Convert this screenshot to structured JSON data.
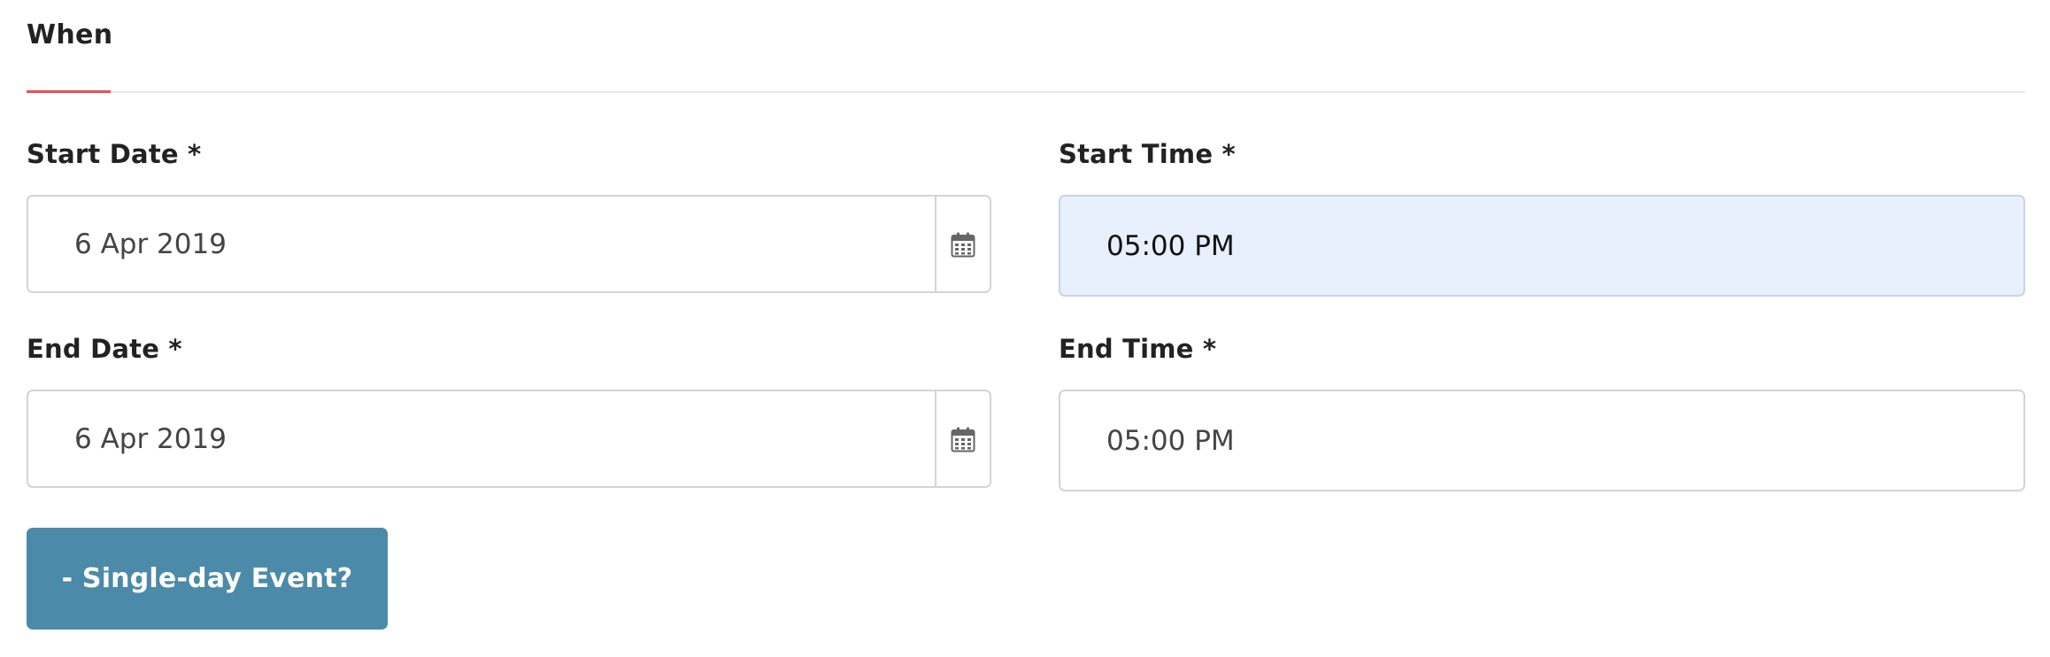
{
  "section": {
    "title": "When"
  },
  "fields": {
    "start_date": {
      "label": "Start Date *",
      "value": "6 Apr 2019",
      "addon_icon": "calendar-icon"
    },
    "start_time": {
      "label": "Start Time *",
      "value": "05:00 PM",
      "autofilled": true
    },
    "end_date": {
      "label": "End Date *",
      "value": "6 Apr 2019",
      "addon_icon": "calendar-icon"
    },
    "end_time": {
      "label": "End Time *",
      "value": "05:00 PM"
    }
  },
  "actions": {
    "single_day_label": "- Single-day Event?"
  },
  "colors": {
    "accent": "#e8505b",
    "button": "#4b8aa8",
    "autofill_bg": "#e8f0fe",
    "border": "#d4d4d4"
  }
}
